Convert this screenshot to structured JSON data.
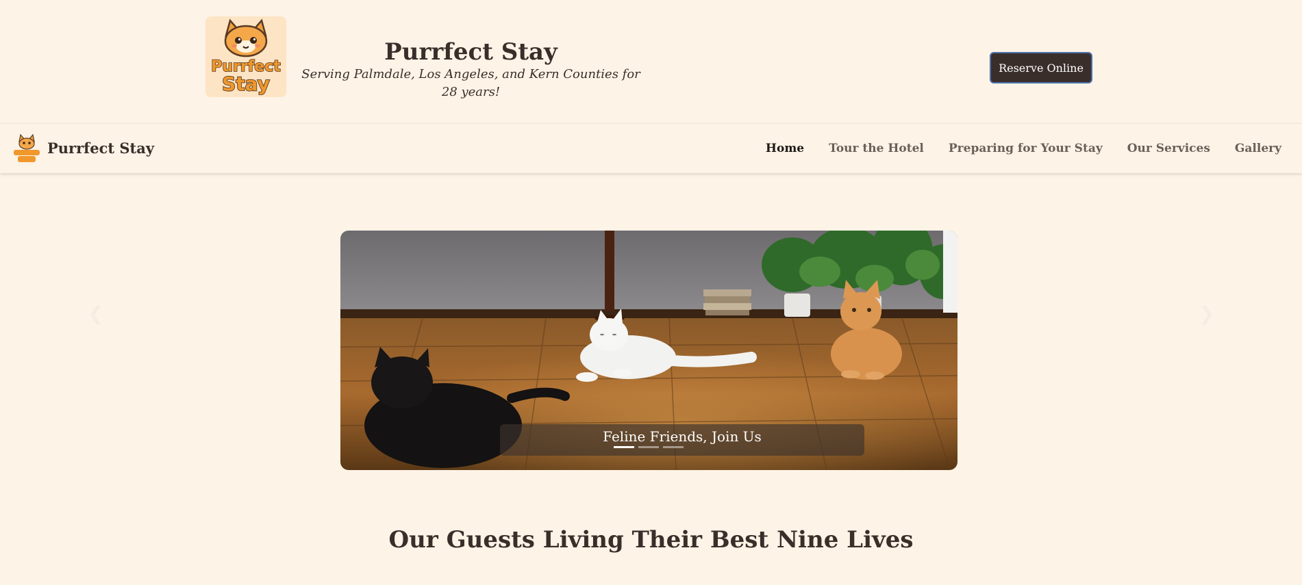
{
  "header": {
    "logo_text_line1": "Purrfect",
    "logo_text_line2": "Stay",
    "title": "Purrfect Stay",
    "tagline": "Serving Palmdale, Los Angeles, and Kern Counties for 28 years!",
    "reserve_label": "Reserve Online"
  },
  "nav": {
    "brand": "Purrfect Stay",
    "items": [
      {
        "label": "Home",
        "active": true
      },
      {
        "label": "Tour the Hotel",
        "active": false
      },
      {
        "label": "Preparing for Your Stay",
        "active": false
      },
      {
        "label": "Our Services",
        "active": false
      },
      {
        "label": "Gallery",
        "active": false
      }
    ]
  },
  "carousel": {
    "caption": "Feline Friends, Join Us",
    "slide_count": 3,
    "active_index": 0,
    "prev_icon": "chevron-left-icon",
    "next_icon": "chevron-right-icon"
  },
  "section": {
    "heading": "Our Guests Living Their Best Nine Lives"
  },
  "colors": {
    "background": "#fdf3e6",
    "text": "#3a2e2b",
    "button": "#3a2e2b",
    "button_border": "#4b6fa8"
  }
}
